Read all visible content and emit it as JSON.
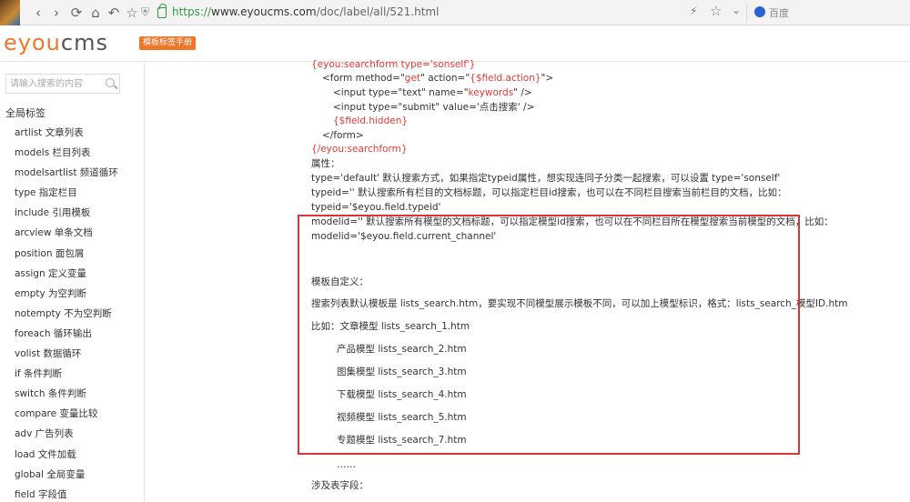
{
  "browser": {
    "url_scheme": "https://",
    "url_domain": "www.eyoucms.com",
    "url_path": "/doc/label/all/521.html",
    "search_engine": "百度",
    "icons": [
      "back-icon",
      "forward-icon",
      "refresh-icon",
      "home-icon",
      "undo-icon",
      "star-icon",
      "shield-icon",
      "lock-icon",
      "bolt-icon",
      "chevron-down-icon",
      "baidu-paw-icon"
    ]
  },
  "site": {
    "logo_e": "eyou",
    "logo_cms": "cms",
    "badge": "模板标签手册",
    "brand_color": "#f0772a"
  },
  "sidebar": {
    "search_placeholder": "请输入搜索的内容",
    "title": "全局标签",
    "items": [
      "artlist 文章列表",
      "models 栏目列表",
      "modelsartlist 频道循环",
      "type 指定栏目",
      "include 引用模板",
      "arcview 单条文档",
      "position 面包屑",
      "assign 定义变量",
      "empty 为空判断",
      "notempty 不为空判断",
      "foreach 循环输出",
      "volist 数据循环",
      "if 条件判断",
      "switch 条件判断",
      "compare 变量比较",
      "adv 广告列表",
      "load 文件加载",
      "global 全局变量",
      "field 字段值"
    ]
  },
  "content": {
    "code_open": "{eyou:searchform type='sonself'}",
    "form_open_a": "<form method=\"",
    "form_method": "get",
    "form_open_b": "\" action=\"",
    "form_action": "{$field.action}",
    "form_open_c": "\">",
    "input1_a": "<input type=\"text\" name=\"",
    "input1_name": "keywords",
    "input1_b": "\" />",
    "input2": "<input type=\"submit\" value='点击搜索' />",
    "field_hidden": "{$field.hidden}",
    "form_close": "</form>",
    "code_close": "{/eyou:searchform}",
    "attrs_title": "属性：",
    "attr_type": "type='default' 默认搜索方式，如果指定typeid属性，想实现连同子分类一起搜索，可以设置 type='sonself'",
    "attr_typeid": "typeid='' 默认搜索所有栏目的文档标题，可以指定栏目id搜索，也可以在不同栏目搜索当前栏目的文档，比如：",
    "attr_typeid_ex": "typeid='$eyou.field.typeid'",
    "attr_modelid": "modelid='' 默认搜索所有模型的文档标题，可以指定模型id搜索，也可以在不同栏目所在模型搜索当前模型的文档，比如：",
    "attr_modelid_ex": "modelid='$eyou.field.current_channel'",
    "tpl_title": "模板自定义：",
    "tpl_desc": "搜索列表默认模板是 lists_search.htm，要实现不同模型展示模板不同，可以加上模型标识，格式：lists_search_模型ID.htm",
    "tpl_example": "比如：文章模型 lists_search_1.htm",
    "tpl_list": [
      "产品模型 lists_search_2.htm",
      "图集模型 lists_search_3.htm",
      "下载模型 lists_search_4.htm",
      "视频模型 lists_search_5.htm",
      "专题模型 lists_search_7.htm"
    ],
    "ellipsis": "……",
    "fields_title": "涉及表字段："
  },
  "colors": {
    "code_red": "#e53935",
    "highlight_border": "#d9343a",
    "secure_green": "#2e9a3e"
  }
}
